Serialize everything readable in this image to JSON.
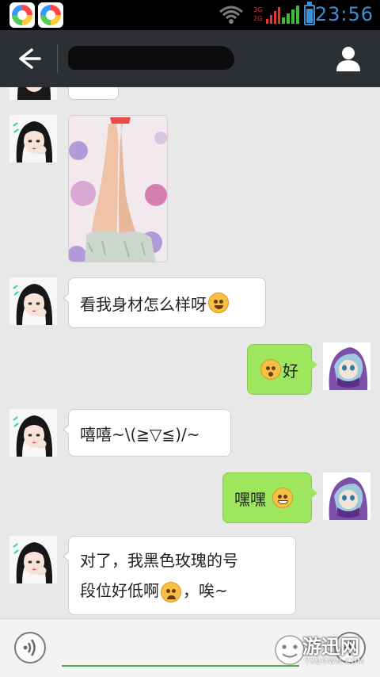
{
  "status_bar": {
    "time": "23:56",
    "network_lines": [
      "3G",
      "2G"
    ],
    "icons": [
      "wifi-icon",
      "signal-icon",
      "battery-icon"
    ]
  },
  "header": {
    "title": "",
    "back_icon": "back-arrow-icon",
    "profile_icon": "person-icon"
  },
  "messages": [
    {
      "side": "left",
      "type": "image",
      "description_icon": "photo"
    },
    {
      "side": "left",
      "type": "text",
      "text": "看我身材怎么样呀",
      "emoji": "heart-eyes-emoji"
    },
    {
      "side": "right",
      "type": "text",
      "text": "好",
      "emoji": "shocked-emoji"
    },
    {
      "side": "left",
      "type": "text",
      "text": "嘻嘻~\\(≧▽≦)/~"
    },
    {
      "side": "right",
      "type": "text",
      "text": "嘿嘿",
      "emoji": "grin-emoji"
    },
    {
      "side": "left",
      "type": "text",
      "line1": "对了，我黑色玫瑰的号",
      "line2a": "段位好低啊",
      "line2b": "，唉~",
      "emoji": "sad-emoji"
    }
  ],
  "input": {
    "placeholder": "",
    "voice_icon": "voice-icon",
    "plus_icon": "plus-icon"
  },
  "watermark": {
    "text": "游迅网",
    "sub": "YXDOWN.COM"
  },
  "colors": {
    "status_time": "#3d8fd6",
    "title_bar": "#2c3035",
    "chat_background": "#e8e8e8",
    "my_bubble": "#9ee65e",
    "their_bubble": "#ffffff"
  }
}
